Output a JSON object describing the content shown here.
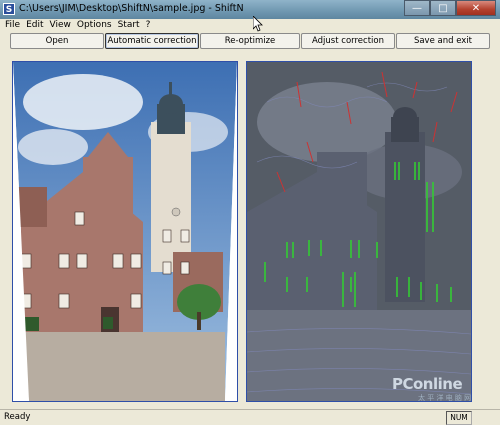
{
  "window": {
    "title": "C:\\Users\\JIM\\Desktop\\ShiftN\\sample.jpg - ShiftN",
    "app_icon_glyph": "S",
    "controls": {
      "minimize": "—",
      "maximize": "□",
      "close": "✕"
    }
  },
  "menu": [
    "File",
    "Edit",
    "View",
    "Options",
    "Start",
    "?"
  ],
  "toolbar": {
    "buttons": [
      {
        "label": "Open"
      },
      {
        "label": "Automatic correction",
        "active": true
      },
      {
        "label": "Re-optimize"
      },
      {
        "label": "Adjust correction"
      },
      {
        "label": "Save and exit"
      }
    ]
  },
  "status": {
    "text": "Ready",
    "num_indicator": "NUM"
  },
  "watermark": {
    "brand": "PConline",
    "sub": "太 平 洋 电 脑 网"
  },
  "colors": {
    "panel_border": "#2f4fa8",
    "chrome": "#ece9d8",
    "edge_lines_vertical": "#33cc33",
    "edge_lines_other": "#cc3333"
  }
}
